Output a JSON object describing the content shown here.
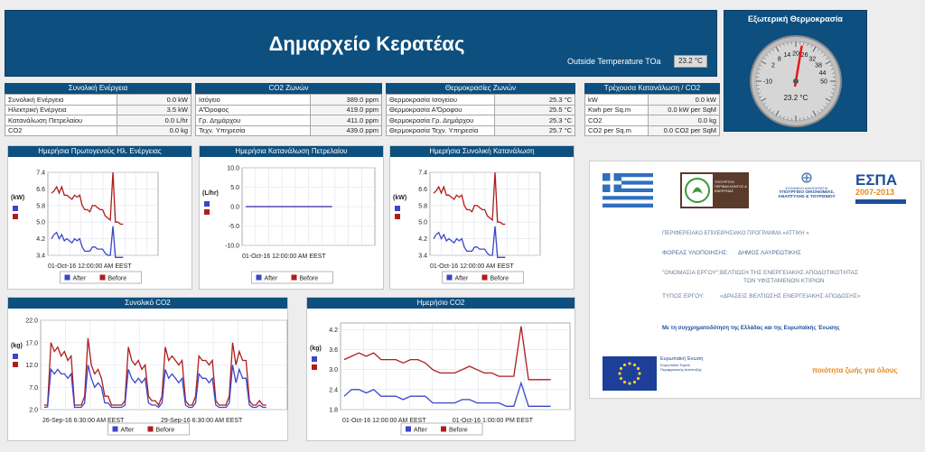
{
  "header": {
    "title": "Δημαρχείο Κερατέας",
    "outside_label": "Outside Temperature TOa",
    "outside_value": "23.2 °C"
  },
  "gauge": {
    "title": "Εξωτερική Θερμοκρασία",
    "value": 23.2,
    "value_label": "23.2 °C",
    "ticks": [
      "-10",
      "2",
      "8",
      "20",
      "32",
      "44",
      "50",
      "38",
      "26",
      "14"
    ]
  },
  "tables": [
    {
      "title": "Συνολική Ενέργεια",
      "rows": [
        {
          "label": "Συνολική Ενέργεια",
          "value": "0.0 kW"
        },
        {
          "label": "Ηλεκτρική Ενέργεια",
          "value": "3.5 kW"
        },
        {
          "label": "Κατανάλωση Πετρελαίου",
          "value": "0.0 L/hr"
        },
        {
          "label": "CO2",
          "value": "0.0 kg"
        }
      ]
    },
    {
      "title": "CO2 Ζωνών",
      "rows": [
        {
          "label": "Ισόγειο",
          "value": "389.0 ppm"
        },
        {
          "label": "Α'Όροφος",
          "value": "419.0 ppm"
        },
        {
          "label": "Γρ. Δημάρχου",
          "value": "411.0 ppm"
        },
        {
          "label": "Τεχν. Υπηρεσία",
          "value": "439.0 ppm"
        }
      ]
    },
    {
      "title": "Θερμοκρασίες Ζωνών",
      "rows": [
        {
          "label": "Θερμοκρασία Ισογείου",
          "value": "25.3 °C"
        },
        {
          "label": "Θερμοκρασία Α'Όροφου",
          "value": "25.5 °C"
        },
        {
          "label": "Θερμοκρασία Γρ. Δημάρχου",
          "value": "25.3 °C"
        },
        {
          "label": "Θερμοκρασία Τεχν. Υπηρεσία",
          "value": "25.7 °C"
        }
      ]
    },
    {
      "title": "Τρέχουσα Κατανάλωση / CO2",
      "rows": [
        {
          "label": "kW",
          "value": "0.0 kW"
        },
        {
          "label": "Kwh per Sq.m",
          "value": "0.0 kW per SqM"
        },
        {
          "label": "CO2",
          "value": "0.0 kg"
        },
        {
          "label": "CO2 per Sq.m",
          "value": "0.0 CO2 per SqM"
        }
      ]
    }
  ],
  "legend": {
    "after": "After",
    "before": "Before"
  },
  "colors": {
    "header": "#0d4f7e",
    "after": "#3b46c9",
    "before": "#b01c1c"
  },
  "chart_data": [
    {
      "type": "line",
      "title": "Ημερήσια Πρωτογενούς Ηλ. Ενέργειας",
      "ylabel": "(kW)",
      "yticks": [
        "7.4",
        "6.6",
        "5.8",
        "5.0",
        "4.2",
        "3.4"
      ],
      "ylim": [
        3.4,
        7.4
      ],
      "xlabel_tick": "01-Oct-16 12:00:00 AM EEST",
      "series": [
        {
          "name": "Before",
          "values": [
            6.4,
            6.5,
            6.7,
            6.4,
            6.7,
            6.3,
            6.3,
            6.2,
            6.1,
            6.3,
            6.2,
            6.3,
            5.8,
            5.6,
            5.6,
            5.5,
            5.8,
            5.8,
            5.7,
            5.6,
            5.6,
            5.3,
            5.2,
            5.1,
            7.4,
            5.0,
            5.0,
            4.9,
            4.9
          ]
        },
        {
          "name": "After",
          "values": [
            4.2,
            4.4,
            4.5,
            4.2,
            4.4,
            4.1,
            4.2,
            4.1,
            4.0,
            4.2,
            4.1,
            4.2,
            3.8,
            3.6,
            3.6,
            3.6,
            3.8,
            3.8,
            3.7,
            3.7,
            3.7,
            3.5,
            3.4,
            3.4,
            4.8,
            3.3,
            3.3,
            3.3,
            3.3
          ]
        }
      ]
    },
    {
      "type": "line",
      "title": "Ημερήσια Κατανάλωση Πετρελαίου",
      "ylabel": "(L/hr)",
      "yticks": [
        "10.0",
        "5.0",
        "0.0",
        "-5.0",
        "-10.0"
      ],
      "ylim": [
        -10,
        10
      ],
      "xlabel_tick": "01-Oct-16 12:00:00 AM EEST",
      "series": [
        {
          "name": "Before",
          "values": [
            0,
            0,
            0,
            0,
            0,
            0,
            0,
            0,
            0,
            0,
            0,
            0,
            0,
            0,
            0,
            0,
            0,
            0
          ]
        },
        {
          "name": "After",
          "values": [
            0,
            0,
            0,
            0,
            0,
            0,
            0,
            0,
            0,
            0,
            0,
            0,
            0,
            0,
            0,
            0,
            0,
            0
          ]
        }
      ]
    },
    {
      "type": "line",
      "title": "Ημερήσια Συνολική Κατανάλωση",
      "ylabel": "(kW)",
      "yticks": [
        "7.4",
        "6.6",
        "5.8",
        "5.0",
        "4.2",
        "3.4"
      ],
      "ylim": [
        3.4,
        7.4
      ],
      "xlabel_tick": "01-Oct-16 12:00:00 AM EEST",
      "series": [
        {
          "name": "Before",
          "values": [
            6.4,
            6.5,
            6.7,
            6.4,
            6.7,
            6.3,
            6.3,
            6.2,
            6.1,
            6.3,
            6.2,
            6.3,
            5.8,
            5.6,
            5.6,
            5.5,
            5.8,
            5.8,
            5.7,
            5.6,
            5.6,
            5.3,
            5.2,
            5.1,
            7.4,
            5.0,
            5.0,
            4.9,
            4.9
          ]
        },
        {
          "name": "After",
          "values": [
            4.2,
            4.4,
            4.5,
            4.2,
            4.4,
            4.1,
            4.2,
            4.1,
            4.0,
            4.2,
            4.1,
            4.2,
            3.8,
            3.6,
            3.6,
            3.6,
            3.8,
            3.8,
            3.7,
            3.7,
            3.7,
            3.5,
            3.4,
            3.4,
            4.8,
            3.3,
            3.3,
            3.3,
            3.3
          ]
        }
      ]
    },
    {
      "type": "line",
      "title": "Συνολικό CO2",
      "ylabel": "(kg)",
      "yticks": [
        "22.0",
        "17.0",
        "12.0",
        "7.0",
        "2.0"
      ],
      "ylim": [
        2,
        22
      ],
      "xticks": [
        "26-Sep-16 6:30:00 AM EEST",
        "29-Sep-16 6:30:00 AM EEST"
      ],
      "series": [
        {
          "name": "Before",
          "values": [
            3,
            3,
            17,
            15,
            16,
            14,
            15,
            13,
            14,
            3,
            3,
            3,
            5,
            18,
            12,
            10,
            11,
            9,
            5,
            5,
            3,
            3,
            3,
            3,
            4,
            16,
            13,
            12,
            13,
            11,
            12,
            5,
            4,
            4,
            3,
            5,
            16,
            13,
            14,
            13,
            12,
            13,
            4,
            3,
            3,
            5,
            14,
            13,
            13,
            12,
            13,
            4,
            3,
            3,
            3,
            5,
            17,
            12,
            15,
            13,
            13,
            4,
            3,
            3,
            4,
            3,
            3
          ]
        },
        {
          "name": "After",
          "values": [
            2.5,
            2.6,
            11,
            10,
            11,
            10,
            10,
            9,
            10,
            2.5,
            2.5,
            2.5,
            3.5,
            12,
            9,
            7,
            8,
            7,
            3.5,
            3.5,
            2.5,
            2.5,
            2.5,
            2.5,
            3,
            11,
            9,
            8,
            9,
            8,
            9,
            3.5,
            3,
            3,
            2.5,
            3.5,
            11,
            9,
            10,
            9,
            8,
            9,
            3,
            2.5,
            2.5,
            3.5,
            10,
            9,
            9,
            8,
            9,
            3,
            2.5,
            2.5,
            2.5,
            3.5,
            12,
            8,
            11,
            9,
            9,
            3,
            2.5,
            2.5,
            3,
            2.5,
            2.5
          ]
        }
      ]
    },
    {
      "type": "line",
      "title": "Ημερήσιο CO2",
      "ylabel": "(kg)",
      "yticks": [
        "4.2",
        "3.6",
        "3.0",
        "2.4",
        "1.8"
      ],
      "ylim": [
        1.8,
        4.4
      ],
      "xticks": [
        "01-Oct-16 12:00:00 AM EEST",
        "01-Oct-16 1:00:00 PM EEST"
      ],
      "series": [
        {
          "name": "Before",
          "values": [
            3.3,
            3.4,
            3.5,
            3.4,
            3.5,
            3.3,
            3.3,
            3.3,
            3.2,
            3.3,
            3.3,
            3.2,
            3.0,
            2.9,
            2.9,
            2.9,
            3.0,
            3.1,
            3.0,
            2.9,
            2.9,
            2.8,
            2.8,
            2.8,
            4.3,
            2.7,
            2.7,
            2.7,
            2.7
          ]
        },
        {
          "name": "After",
          "values": [
            2.2,
            2.4,
            2.4,
            2.3,
            2.4,
            2.2,
            2.2,
            2.2,
            2.1,
            2.2,
            2.2,
            2.2,
            2.0,
            2.0,
            2.0,
            2.0,
            2.1,
            2.1,
            2.0,
            2.0,
            2.0,
            2.0,
            1.9,
            1.9,
            2.6,
            1.9,
            1.9,
            1.9,
            1.9
          ]
        }
      ]
    }
  ],
  "logos": {
    "ministry": "ΥΠΟΥΡΓΕΙΟ ΠΕΡΙΒΑΛΛΟΝΤΟΣ & ΕΝΕΡΓΕΙΑΣ",
    "ministry2_line1": "ΕΛΛΗΝΙΚΗ ΔΗΜΟΚΡΑΤΙΑ",
    "ministry2_line2": "ΥΠΟΥΡΓΕΙΟ ΟΙΚΟΝΟΜΙΑΣ,",
    "ministry2_line3": "ΑΝΑΠΤΥΞΗΣ & ΤΟΥΡΙΣΜΟΥ",
    "espa": "ΕΣΠΑ",
    "espa_years": "2007-2013",
    "program": "ΠΕΡΙΦΕΡΕΙΑΚΟ ΕΠΙΧΕΙΡΗΣΙΑΚΟ ΠΡΟΓΡΑΜΜΑ «ΑΤΤΙΚΗ »",
    "body_label": "ΦΟΡΕΑΣ ΥΛΟΠΟΙΗΣΗΣ:",
    "body_value": "ΔΗΜΟΣ ΛΑΥΡΕΩΤΙΚΗΣ",
    "project_label": "\"ΟΝΟΜΑΣΙΑ ΕΡΓΟΥ\":",
    "project_line1": "ΒΕΛΤΙΩΣΗ ΤΗΣ ΕΝΕΡΓΕΙΑΚΗΣ ΑΠΟΔΟΤΙΚΟΤΗΤΑΣ",
    "project_line2": "ΤΩΝ ΥΦΙΣΤΑΜΕΝΩΝ ΚΤΙΡΙΩΝ",
    "type_label": "ΤΥΠΟΣ ΕΡΓΟΥ:",
    "type_value": "«ΔΡΑΣΕΙΣ ΒΕΛΤΙΩΣΗΣ ΕΝΕΡΓΕΙΑΚΗΣ ΑΠΟΔΟΣΗΣ»",
    "cofund": "Με τη συγχρηματοδότηση της Ελλάδας και της Ευρωπαϊκής Ένωσης",
    "eu_line1": "Ευρωπαϊκή Ένωση",
    "eu_line2": "Ευρωπαϊκό Ταμείο",
    "eu_line3": "Περιφερειακής Ανάπτυξης",
    "slogan": "ποιότητα ζωής για όλους"
  }
}
